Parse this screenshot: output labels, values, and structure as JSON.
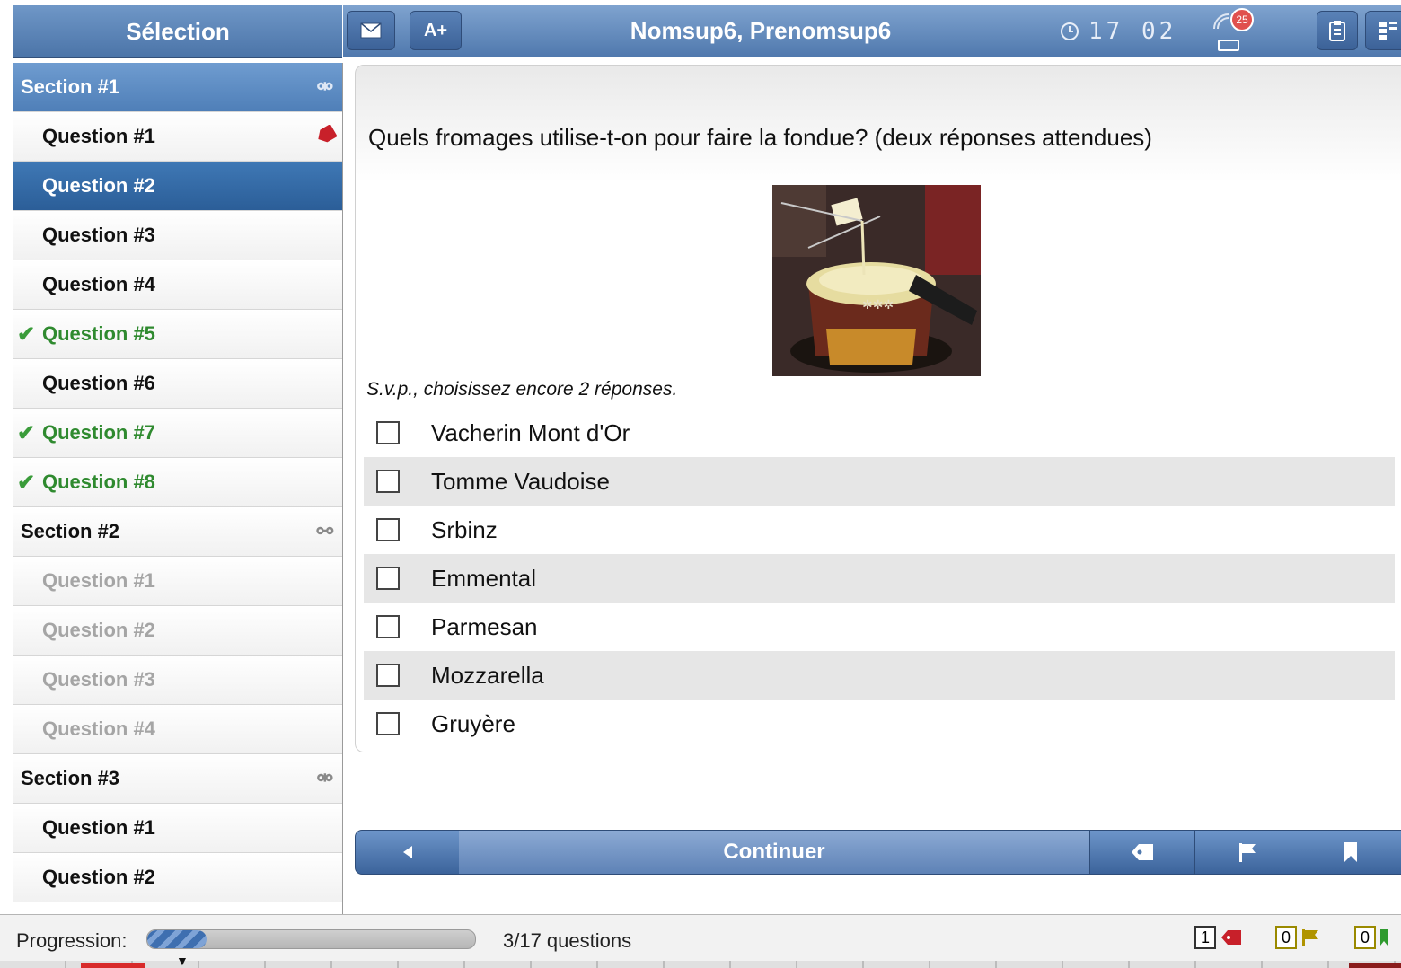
{
  "sidebar_header": {
    "title": "Sélection"
  },
  "topbar": {
    "mail_icon": "envelope-icon",
    "font_button": "A+",
    "student_name": "Nomsup6, Prenomsup6",
    "clock_icon": "clock-icon",
    "time": "17 02",
    "notification_count": "25",
    "right_icons": [
      "clipboard-icon",
      "grid-icon"
    ]
  },
  "sidebar": {
    "items": [
      {
        "label": "Section #1",
        "kind": "section",
        "state": "selected-section",
        "icon": "unlinked-icon"
      },
      {
        "label": "Question #1",
        "kind": "question",
        "state": "normal",
        "icon": "tag-icon"
      },
      {
        "label": "Question #2",
        "kind": "question",
        "state": "selected"
      },
      {
        "label": "Question #3",
        "kind": "question",
        "state": "normal"
      },
      {
        "label": "Question #4",
        "kind": "question",
        "state": "normal"
      },
      {
        "label": "Question #5",
        "kind": "question",
        "state": "done"
      },
      {
        "label": "Question #6",
        "kind": "question",
        "state": "normal"
      },
      {
        "label": "Question #7",
        "kind": "question",
        "state": "done"
      },
      {
        "label": "Question #8",
        "kind": "question",
        "state": "done"
      },
      {
        "label": "Section #2",
        "kind": "section",
        "state": "normal",
        "icon": "link-icon"
      },
      {
        "label": "Question #1",
        "kind": "question",
        "state": "disabled"
      },
      {
        "label": "Question #2",
        "kind": "question",
        "state": "disabled"
      },
      {
        "label": "Question #3",
        "kind": "question",
        "state": "disabled"
      },
      {
        "label": "Question #4",
        "kind": "question",
        "state": "disabled"
      },
      {
        "label": "Section #3",
        "kind": "section",
        "state": "normal",
        "icon": "unlinked-icon"
      },
      {
        "label": "Question #1",
        "kind": "question",
        "state": "normal"
      },
      {
        "label": "Question #2",
        "kind": "question",
        "state": "normal"
      }
    ]
  },
  "question": {
    "text": "Quels fromages utilise-t-on pour faire la fondue? (deux réponses attendues)",
    "image": "fondue-photo",
    "instruction": "S.v.p., choisissez encore 2 réponses.",
    "answers": [
      {
        "label": "Vacherin Mont d'Or",
        "checked": false
      },
      {
        "label": "Tomme Vaudoise",
        "checked": false
      },
      {
        "label": "Srbinz",
        "checked": false
      },
      {
        "label": "Emmental",
        "checked": false
      },
      {
        "label": "Parmesan",
        "checked": false
      },
      {
        "label": "Mozzarella",
        "checked": false
      },
      {
        "label": "Gruyère",
        "checked": false
      }
    ]
  },
  "navbar": {
    "back_icon": "back-arrow-icon",
    "continue_label": "Continuer",
    "icons": [
      "tag-icon",
      "flag-icon",
      "bookmark-icon"
    ]
  },
  "status": {
    "progress_label": "Progression:",
    "progress_fraction": 0.18,
    "progress_text": "3/17 questions",
    "tag_count": "1",
    "flag_count": "0",
    "bookmark_count": "0"
  },
  "colors": {
    "header_blue": "#4f78ad",
    "selected_blue": "#2b5e98",
    "done_green": "#2f8a2f",
    "tag_red": "#c8202a"
  }
}
